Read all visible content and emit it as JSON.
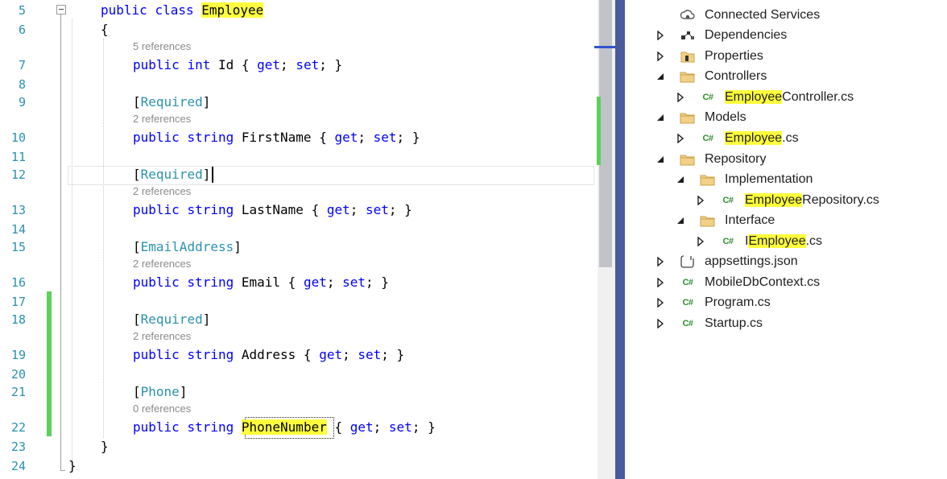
{
  "editor": {
    "lines": [
      {
        "num": "5",
        "tokens": [
          {
            "t": "public",
            "c": "kw"
          },
          {
            "t": " "
          },
          {
            "t": "class",
            "c": "kw"
          },
          {
            "t": " "
          },
          {
            "t": "Employee",
            "c": "hl"
          }
        ]
      },
      {
        "num": "6",
        "tokens": [
          {
            "t": "{"
          }
        ]
      },
      {
        "num": "7",
        "ref": "5 references",
        "tokens": [
          {
            "t": "public",
            "c": "kw"
          },
          {
            "t": " "
          },
          {
            "t": "int",
            "c": "kw"
          },
          {
            "t": " Id { "
          },
          {
            "t": "get",
            "c": "kw"
          },
          {
            "t": "; "
          },
          {
            "t": "set",
            "c": "kw"
          },
          {
            "t": "; }"
          }
        ]
      },
      {
        "num": "8",
        "tokens": []
      },
      {
        "num": "9",
        "tokens": [
          {
            "t": "["
          },
          {
            "t": "Required",
            "c": "attr"
          },
          {
            "t": "]"
          }
        ]
      },
      {
        "num": "10",
        "ref": "2 references",
        "tokens": [
          {
            "t": "public",
            "c": "kw"
          },
          {
            "t": " "
          },
          {
            "t": "string",
            "c": "kw"
          },
          {
            "t": " FirstName { "
          },
          {
            "t": "get",
            "c": "kw"
          },
          {
            "t": "; "
          },
          {
            "t": "set",
            "c": "kw"
          },
          {
            "t": "; }"
          }
        ]
      },
      {
        "num": "11",
        "tokens": []
      },
      {
        "num": "12",
        "tokens": [
          {
            "t": "["
          },
          {
            "t": "Required",
            "c": "attr"
          },
          {
            "t": "]"
          }
        ]
      },
      {
        "num": "13",
        "ref": "2 references",
        "tokens": [
          {
            "t": "public",
            "c": "kw"
          },
          {
            "t": " "
          },
          {
            "t": "string",
            "c": "kw"
          },
          {
            "t": " LastName { "
          },
          {
            "t": "get",
            "c": "kw"
          },
          {
            "t": "; "
          },
          {
            "t": "set",
            "c": "kw"
          },
          {
            "t": "; }"
          }
        ]
      },
      {
        "num": "14",
        "tokens": []
      },
      {
        "num": "15",
        "tokens": [
          {
            "t": "["
          },
          {
            "t": "EmailAddress",
            "c": "attr"
          },
          {
            "t": "]"
          }
        ]
      },
      {
        "num": "16",
        "ref": "2 references",
        "tokens": [
          {
            "t": "public",
            "c": "kw"
          },
          {
            "t": " "
          },
          {
            "t": "string",
            "c": "kw"
          },
          {
            "t": " Email { "
          },
          {
            "t": "get",
            "c": "kw"
          },
          {
            "t": "; "
          },
          {
            "t": "set",
            "c": "kw"
          },
          {
            "t": "; }"
          }
        ]
      },
      {
        "num": "17",
        "tokens": []
      },
      {
        "num": "18",
        "tokens": [
          {
            "t": "["
          },
          {
            "t": "Required",
            "c": "attr"
          },
          {
            "t": "]"
          }
        ]
      },
      {
        "num": "19",
        "ref": "2 references",
        "tokens": [
          {
            "t": "public",
            "c": "kw"
          },
          {
            "t": " "
          },
          {
            "t": "string",
            "c": "kw"
          },
          {
            "t": " Address { "
          },
          {
            "t": "get",
            "c": "kw"
          },
          {
            "t": "; "
          },
          {
            "t": "set",
            "c": "kw"
          },
          {
            "t": "; }"
          }
        ]
      },
      {
        "num": "20",
        "tokens": []
      },
      {
        "num": "21",
        "tokens": [
          {
            "t": "["
          },
          {
            "t": "Phone",
            "c": "attr"
          },
          {
            "t": "]"
          }
        ]
      },
      {
        "num": "22",
        "ref": "0 references",
        "tokens": [
          {
            "t": "public",
            "c": "kw"
          },
          {
            "t": " "
          },
          {
            "t": "string",
            "c": "kw"
          },
          {
            "t": " "
          },
          {
            "t": "PhoneNumber",
            "c": "hl"
          },
          {
            "t": " { "
          },
          {
            "t": "get",
            "c": "kw"
          },
          {
            "t": "; "
          },
          {
            "t": "set",
            "c": "kw"
          },
          {
            "t": "; }"
          }
        ]
      },
      {
        "num": "23",
        "tokens": [
          {
            "t": "}"
          }
        ]
      },
      {
        "num": "24",
        "tokens": [
          {
            "t": "}"
          }
        ]
      }
    ]
  },
  "explorer": {
    "items": [
      {
        "label": "Connected Services",
        "icon": "connected-services-icon",
        "expander": "none"
      },
      {
        "label": "Dependencies",
        "icon": "dependencies-icon",
        "expander": "collapsed"
      },
      {
        "label": "Properties",
        "icon": "properties-icon",
        "expander": "collapsed"
      },
      {
        "label": "Controllers",
        "icon": "folder-icon",
        "expander": "expanded"
      },
      {
        "label_hl": "Employee",
        "label_rest": "Controller.cs",
        "icon": "csharp-file-icon",
        "expander": "collapsed"
      },
      {
        "label": "Models",
        "icon": "folder-icon",
        "expander": "expanded"
      },
      {
        "label_hl": "Employee",
        "label_rest": ".cs",
        "icon": "csharp-file-icon",
        "expander": "collapsed"
      },
      {
        "label": "Repository",
        "icon": "folder-icon",
        "expander": "expanded"
      },
      {
        "label": "Implementation",
        "icon": "folder-icon",
        "expander": "expanded"
      },
      {
        "label_hl": "Employee",
        "label_rest": "Repository.cs",
        "icon": "csharp-file-icon",
        "expander": "collapsed"
      },
      {
        "label": "Interface",
        "icon": "folder-icon",
        "expander": "expanded"
      },
      {
        "label_pre": "I",
        "label_hl": "Employee",
        "label_rest": ".cs",
        "icon": "csharp-file-icon",
        "expander": "collapsed"
      },
      {
        "label": "appsettings.json",
        "icon": "json-settings-icon",
        "expander": "collapsed"
      },
      {
        "label": "MobileDbContext.cs",
        "icon": "csharp-file-icon",
        "expander": "collapsed"
      },
      {
        "label": "Program.cs",
        "icon": "csharp-file-icon",
        "expander": "collapsed"
      },
      {
        "label": "Startup.cs",
        "icon": "csharp-file-icon",
        "expander": "collapsed"
      }
    ]
  }
}
